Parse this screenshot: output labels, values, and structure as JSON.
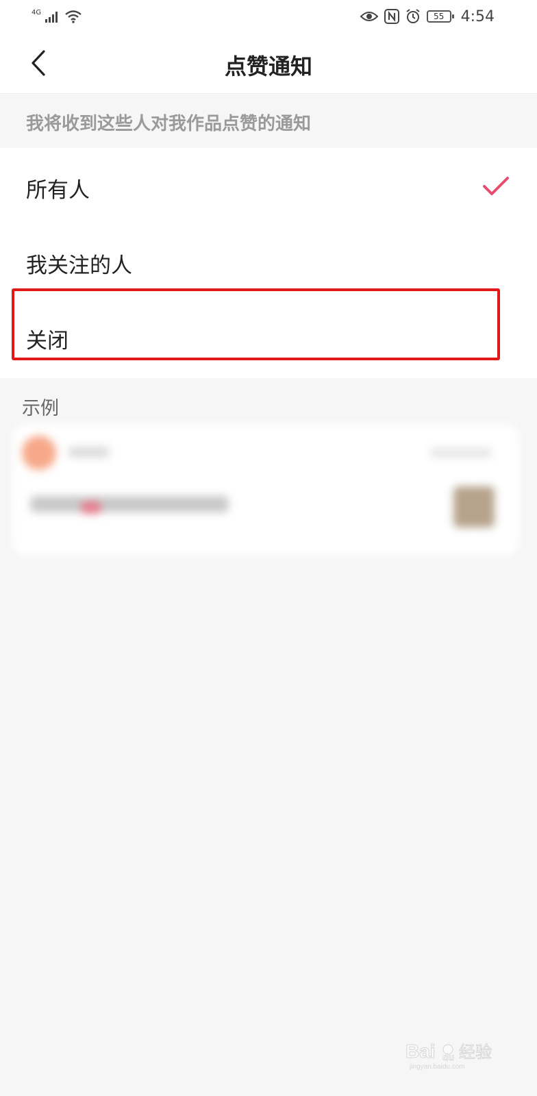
{
  "status_bar": {
    "network": "4G",
    "battery": "55",
    "time": "4:54"
  },
  "nav": {
    "title": "点赞通知"
  },
  "section": {
    "description": "我将收到这些人对我作品点赞的通知"
  },
  "options": [
    {
      "label": "所有人",
      "selected": true
    },
    {
      "label": "我关注的人",
      "selected": false
    },
    {
      "label": "关闭",
      "selected": false
    }
  ],
  "example": {
    "label": "示例"
  },
  "watermark": {
    "text": "Baidu经验",
    "subtext": "jingyan.baidu.com"
  },
  "colors": {
    "accent": "#e84c6e",
    "highlight": "#e01818",
    "background": "#f6f6f6"
  }
}
